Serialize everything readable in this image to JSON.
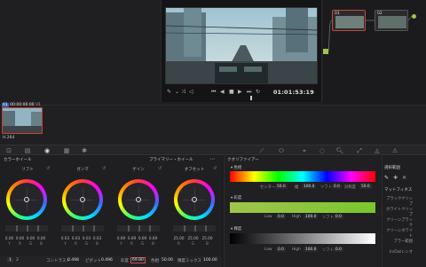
{
  "viewer": {
    "timecode": "01:01:53:19"
  },
  "nodes": {
    "node1": "01",
    "node2": "02"
  },
  "clip": {
    "index": "01",
    "timecode": "00:00:00:00",
    "track": "V1",
    "codec": "H.264"
  },
  "wheels": {
    "panel_title": "カラーホイール",
    "mode_title": "プライマリー・ホイール",
    "items": [
      {
        "label": "リフト",
        "vals": [
          "0.00",
          "0.00",
          "0.00",
          "0.00"
        ],
        "keys": [
          "Y",
          "R",
          "G",
          "B"
        ]
      },
      {
        "label": "ガンマ",
        "vals": [
          "0.03",
          "0.03",
          "0.03",
          "0.03"
        ],
        "keys": [
          "Y",
          "R",
          "G",
          "B"
        ]
      },
      {
        "label": "ゲイン",
        "vals": [
          "0.69",
          "0.69",
          "0.69",
          "0.69"
        ],
        "keys": [
          "Y",
          "R",
          "G",
          "B"
        ]
      },
      {
        "label": "オフセット",
        "vals": [
          "25.00",
          "25.00",
          "25.00",
          ""
        ],
        "keys": [
          "R",
          "G",
          "B",
          ""
        ]
      }
    ],
    "footer": {
      "page1": "1",
      "page2": "2",
      "contrast_label": "コントラスト",
      "contrast": "0.498",
      "pivot_label": "ピボット",
      "pivot": "0.496",
      "sat_label": "彩度",
      "sat": "69.80",
      "hue_label": "色相",
      "hue": "50.00",
      "lummix_label": "輝度ミックス",
      "lummix": "100.00"
    }
  },
  "qualifier": {
    "title": "クオリファイアー",
    "hue": {
      "label": "色相",
      "center_label": "センター",
      "center": "50.0",
      "width_label": "幅",
      "width": "100.0",
      "soft_label": "ソフト",
      "soft": "0.0",
      "sym_label": "対称度",
      "sym": "50.0"
    },
    "sat": {
      "label": "彩度",
      "low_label": "Low",
      "low": "0.0",
      "high_label": "High",
      "high": "100.0",
      "soft_label": "ソフト",
      "soft": "0.0"
    },
    "lum": {
      "label": "輝度",
      "low_label": "Low",
      "low": "0.0",
      "high_label": "High",
      "high": "100.0",
      "soft_label": "ソフト",
      "soft": "0.0"
    }
  },
  "right_panel": {
    "title": "選択範囲",
    "mattefinesse": "マットフィネス",
    "rows": [
      "ブラッククリップ",
      "ホワイトクリップ",
      "クリーンブラック",
      "クリーンホワイト",
      "ブラー範囲",
      "In/Outレシオ"
    ]
  }
}
